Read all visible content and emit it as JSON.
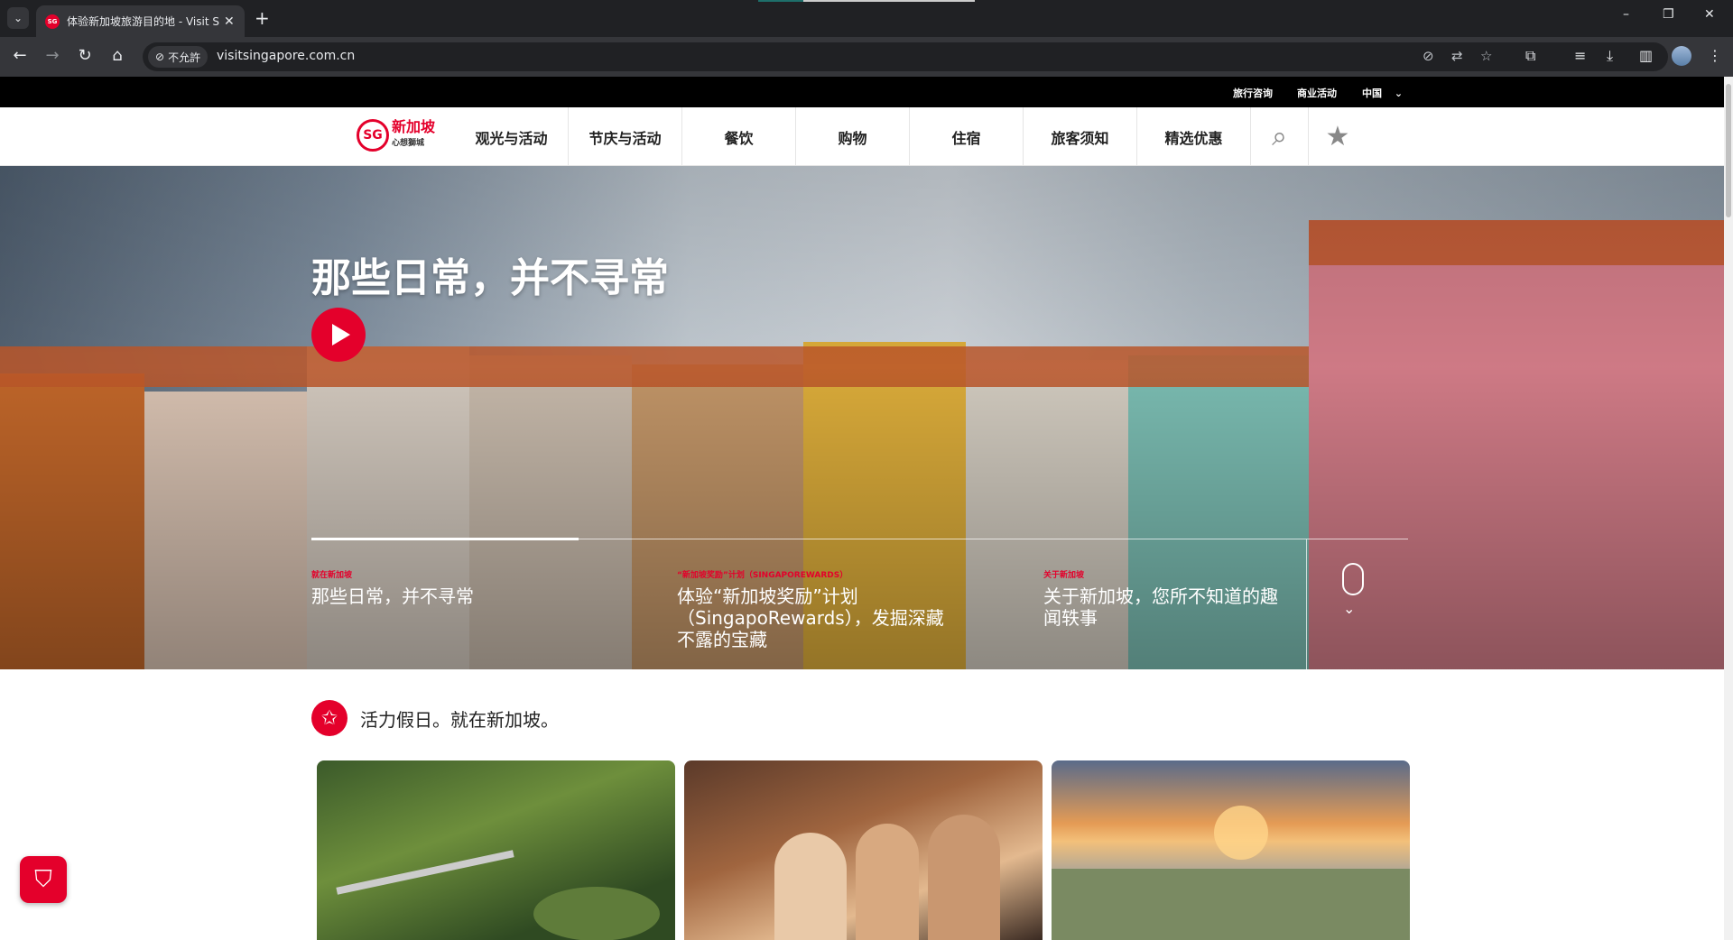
{
  "browser": {
    "tab_title": "体验新加坡旅游目的地 - Visit S",
    "new_tab_label": "+",
    "security_label": "不允許",
    "url": "visitsingapore.com.cn",
    "minimize": "–",
    "restore": "❐",
    "close": "✕"
  },
  "utility_nav": {
    "items": [
      "旅行咨询",
      "商业活动",
      "中国"
    ]
  },
  "logo": {
    "badge": "SG",
    "name": "新加坡",
    "sub": "心想獅城"
  },
  "main_nav": {
    "items": [
      "观光与活动",
      "节庆与活动",
      "餐饮",
      "购物",
      "住宿",
      "旅客须知",
      "精选优惠"
    ]
  },
  "hero": {
    "title": "那些日常，并不寻常",
    "slides": [
      {
        "kicker": "就在新加坡",
        "title": "那些日常，并不寻常"
      },
      {
        "kicker": "“新加坡奖励”计划（SINGAPOREWARDS）",
        "title": "体验“新加坡奖励”计划（SingapoRewards），发掘深藏不露的宝藏"
      },
      {
        "kicker": "关于新加坡",
        "title": "关于新加坡，您所不知道的趣闻轶事"
      }
    ]
  },
  "tagline": "活力假日。就在新加坡。",
  "colors": {
    "brand_red": "#e4002b"
  }
}
